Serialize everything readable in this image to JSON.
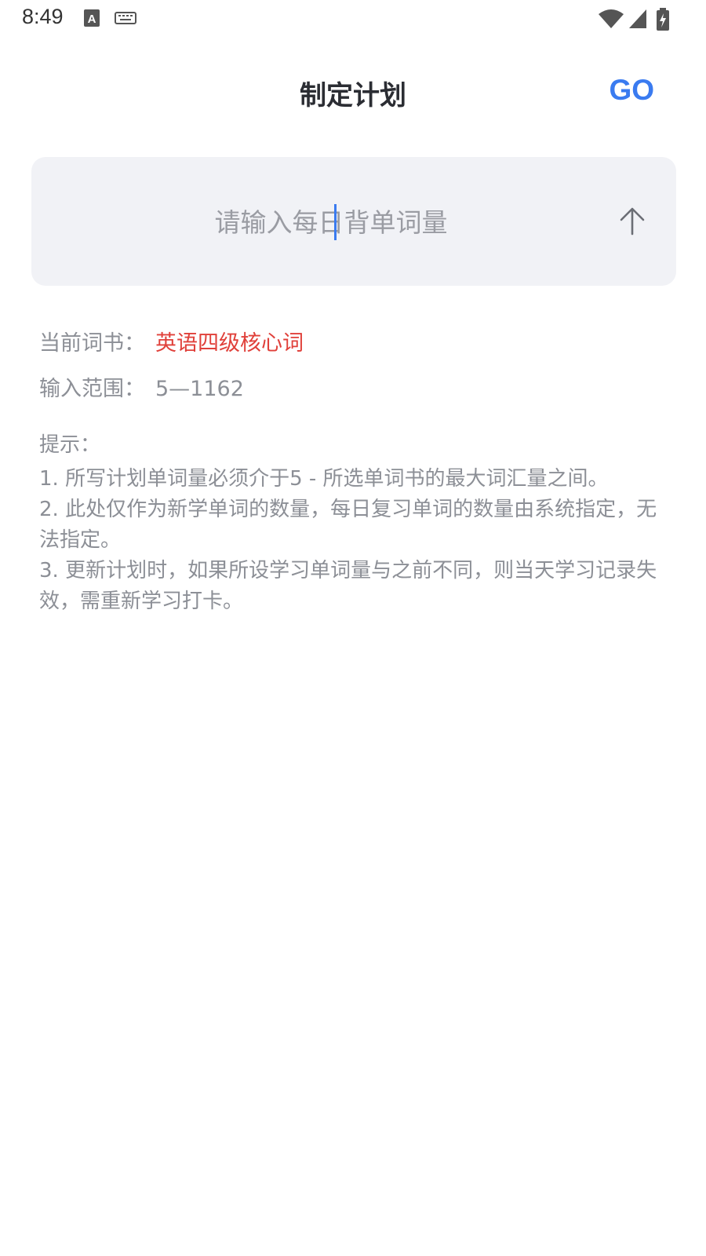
{
  "status_bar": {
    "time": "8:49",
    "icons": [
      "font-icon",
      "keyboard-icon",
      "wifi-icon",
      "cellular-signal-icon",
      "battery-charging-icon"
    ]
  },
  "header": {
    "title": "制定计划",
    "go_label": "GO"
  },
  "plan_input": {
    "placeholder": "请输入每日背单词量",
    "value": "",
    "submit_icon": "arrow-up-icon"
  },
  "info": {
    "current_book_label": "当前词书：",
    "current_book_value": "英语四级核心词",
    "range_label": "输入范围：",
    "range_value": "5—1162"
  },
  "tips": {
    "title": "提示：",
    "items": [
      "1. 所写计划单词量必须介于5 - 所选单词书的最大词汇量之间。",
      "2. 此处仅作为新学单词的数量，每日复习单词的数量由系统指定，无法指定。",
      "3. 更新计划时，如果所设学习单词量与之前不同，则当天学习记录失效，需重新学习打卡。"
    ]
  },
  "colors": {
    "accent": "#3a7bf0",
    "highlight": "#e0403a",
    "muted_text": "#8c8f96",
    "input_bg": "#f1f2f6"
  }
}
